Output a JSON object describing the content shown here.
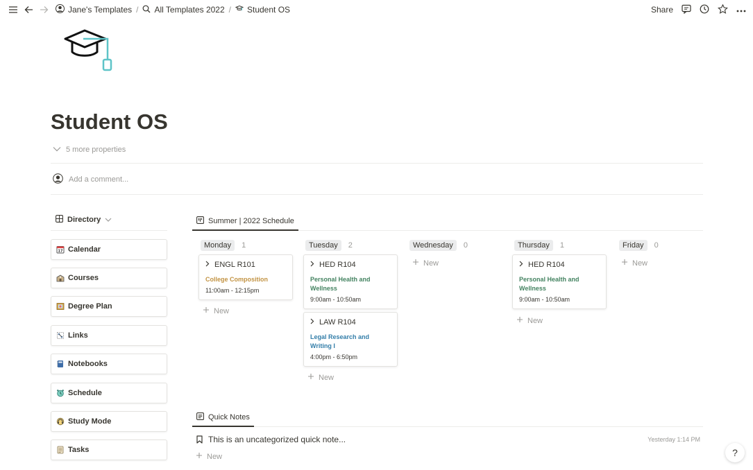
{
  "breadcrumb": {
    "items": [
      "Jane's Templates",
      "All Templates 2022",
      "Student OS"
    ]
  },
  "topbar": {
    "share_label": "Share"
  },
  "page": {
    "title": "Student OS",
    "more_properties": "5 more properties",
    "comment_placeholder": "Add a comment..."
  },
  "directory": {
    "header": "Directory",
    "items": [
      "Calendar",
      "Courses",
      "Degree Plan",
      "Links",
      "Notebooks",
      "Schedule",
      "Study Mode",
      "Tasks"
    ]
  },
  "schedule": {
    "tab_label": "Summer | 2022 Schedule",
    "columns": [
      {
        "name": "Monday",
        "count": "1"
      },
      {
        "name": "Tuesday",
        "count": "2"
      },
      {
        "name": "Wednesday",
        "count": "0"
      },
      {
        "name": "Thursday",
        "count": "1"
      },
      {
        "name": "Friday",
        "count": "0"
      }
    ],
    "cards": [
      {
        "code": "ENGL R101",
        "course": "College Composition",
        "time": "11:00am - 12:15pm",
        "color": "#c29343"
      },
      {
        "code": "HED R104",
        "course": "Personal Health and Wellness",
        "time": "9:00am - 10:50am",
        "color": "#448361"
      },
      {
        "code": "LAW R104",
        "course": "Legal Research and Writing I",
        "time": "4:00pm - 6:50pm",
        "color": "#337ea9"
      },
      {
        "code": "HED R104",
        "course": "Personal Health and Wellness",
        "time": "9:00am - 10:50am",
        "color": "#448361"
      }
    ],
    "new_label": "New"
  },
  "quick_notes": {
    "tab_label": "Quick Notes",
    "note_title": "This is an uncategorized quick note...",
    "note_time": "Yesterday 1:14 PM",
    "new_label": "New"
  },
  "help": {
    "label": "?"
  },
  "colors": {
    "accent_teal": "#5ec4c8",
    "text": "#37352f",
    "muted": "#9b9a97"
  }
}
